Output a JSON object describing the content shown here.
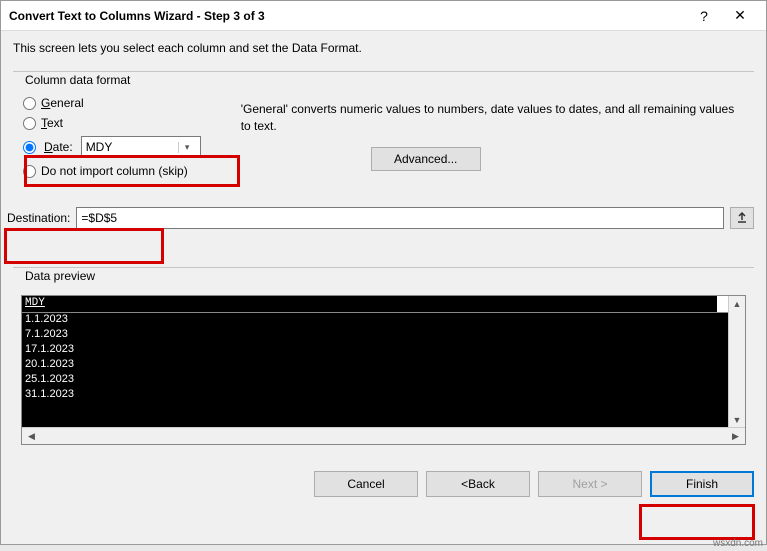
{
  "titlebar": {
    "title": "Convert Text to Columns Wizard - Step 3 of 3",
    "help": "?",
    "close": "✕"
  },
  "instruction": "This screen lets you select each column and set the Data Format.",
  "format": {
    "legend": "Column data format",
    "general": "General",
    "text": "Text",
    "date": "Date:",
    "date_value": "MDY",
    "skip": "Do not import column (skip)"
  },
  "description": "'General' converts numeric values to numbers, date values to dates, and all remaining values to text.",
  "advanced": "Advanced...",
  "destination": {
    "label": "Destination:",
    "value": "=$D$5"
  },
  "preview": {
    "legend": "Data preview",
    "header": "MDY",
    "rows": [
      "1.1.2023",
      "7.1.2023",
      "17.1.2023",
      "20.1.2023",
      "25.1.2023",
      "31.1.2023"
    ]
  },
  "buttons": {
    "cancel": "Cancel",
    "back": "< Back",
    "next": "Next >",
    "finish": "Finish"
  },
  "watermark": "wsxdn.com"
}
